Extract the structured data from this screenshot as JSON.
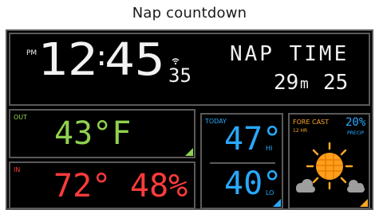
{
  "page": {
    "title": "Nap countdown"
  },
  "clock": {
    "ampm": "PM",
    "hour": "12",
    "colon": ":",
    "minute": "45",
    "seconds": "35"
  },
  "nap": {
    "label": "NAP TIME",
    "minutes": "29",
    "minutes_unit": "m",
    "seconds": "25"
  },
  "outdoor": {
    "label": "OUT",
    "temperature": "43°F"
  },
  "indoor": {
    "label": "IN",
    "temperature": "72°",
    "humidity": "48%"
  },
  "today": {
    "label": "TODAY",
    "high": "47°",
    "high_label": "HI",
    "low": "40°",
    "low_label": "LO"
  },
  "forecast": {
    "label": "FORE CAST",
    "period": "12 HR",
    "precip_value": "20%",
    "precip_label": "PRECIP",
    "icon": "partly-sunny-icon"
  },
  "colors": {
    "out": "#8fd14f",
    "in": "#ff3b3b",
    "today": "#29a9ff",
    "forecast": "#ffa726",
    "segment": "#f2f2f2"
  }
}
